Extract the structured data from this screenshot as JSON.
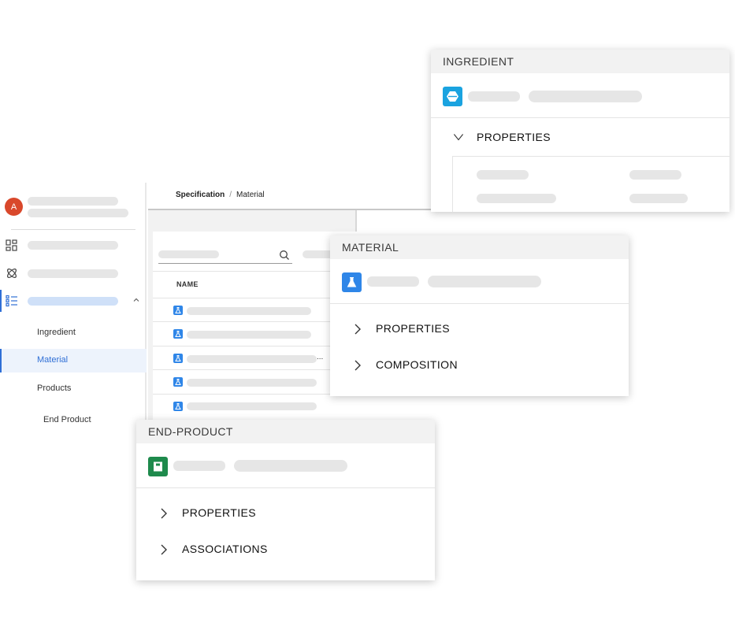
{
  "sidebar": {
    "avatar_initial": "A",
    "sub_items": [
      "Ingredient",
      "Material",
      "Products",
      "End Product"
    ]
  },
  "main": {
    "breadcrumb": {
      "root": "Specification",
      "separator": "/",
      "current": "Material"
    },
    "table": {
      "column_name": "NAME",
      "truncated_marker": "..."
    }
  },
  "cards": {
    "ingredient": {
      "title": "INGREDIENT",
      "sections": [
        "PROPERTIES"
      ],
      "icon_color": "#1aa3e0"
    },
    "material": {
      "title": "MATERIAL",
      "sections": [
        "PROPERTIES",
        "COMPOSITION"
      ],
      "icon_color": "#2f86e8"
    },
    "end_product": {
      "title": "END-PRODUCT",
      "sections": [
        "PROPERTIES",
        "ASSOCIATIONS"
      ],
      "icon_color": "#1e8a4c"
    }
  },
  "colors": {
    "accent": "#2f6fd6",
    "avatar": "#d9482b",
    "skeleton": "#e6e6e6"
  }
}
